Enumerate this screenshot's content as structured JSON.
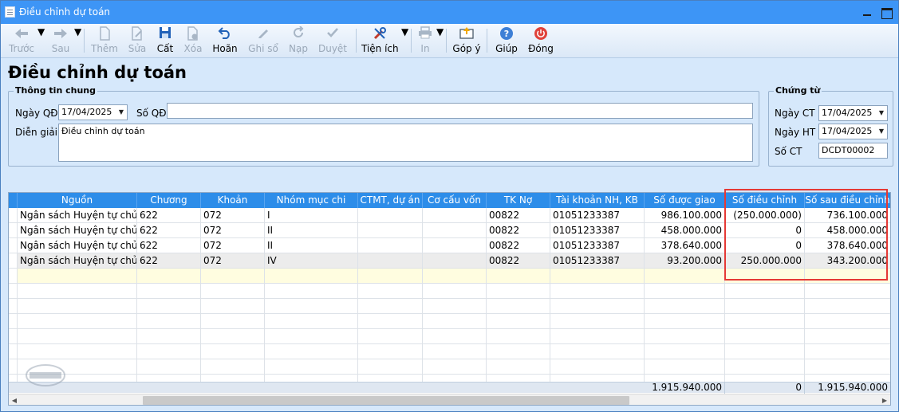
{
  "window": {
    "title": "Điều chỉnh dự toán"
  },
  "toolbar": {
    "prev": "Trước",
    "next": "Sau",
    "add": "Thêm",
    "edit": "Sửa",
    "save": "Cất",
    "delete": "Xóa",
    "undo": "Hoãn",
    "post": "Ghi sổ",
    "reload": "Nạp",
    "approve": "Duyệt",
    "utilities": "Tiện ích",
    "print": "In",
    "feedback": "Góp ý",
    "help": "Giúp",
    "close": "Đóng"
  },
  "page_title": "Điều chỉnh dự toán",
  "general": {
    "legend": "Thông tin chung",
    "decision_date_label": "Ngày QĐ",
    "decision_date": "17/04/2025",
    "decision_no_label": "Số QĐ",
    "decision_no": "",
    "description_label": "Diễn giải",
    "description": "Điều chỉnh dự toán"
  },
  "voucher": {
    "legend": "Chứng từ",
    "voucher_date_label": "Ngày CT",
    "voucher_date": "17/04/2025",
    "accounting_date_label": "Ngày HT",
    "accounting_date": "17/04/2025",
    "voucher_no_label": "Số CT",
    "voucher_no": "DCDT00002"
  },
  "grid": {
    "columns": [
      "Nguồn",
      "Chương",
      "Khoản",
      "Nhóm mục chi",
      "CTMT, dự án",
      "Cơ cấu vốn",
      "TK Nợ",
      "Tài khoản NH, KB",
      "Số được giao",
      "Số điều chỉnh",
      "Số sau điều chỉnh"
    ],
    "rows": [
      [
        "Ngân sách Huyện tự chủ",
        "622",
        "072",
        "I",
        "",
        "",
        "00822",
        "01051233387",
        "986.100.000",
        "(250.000.000)",
        "736.100.000"
      ],
      [
        "Ngân sách Huyện tự chủ",
        "622",
        "072",
        "II",
        "",
        "",
        "00822",
        "01051233387",
        "458.000.000",
        "0",
        "458.000.000"
      ],
      [
        "Ngân sách Huyện tự chủ",
        "622",
        "072",
        "II",
        "",
        "",
        "00822",
        "01051233387",
        "378.640.000",
        "0",
        "378.640.000"
      ],
      [
        "Ngân sách Huyện tự chủ",
        "622",
        "072",
        "IV",
        "",
        "",
        "00822",
        "01051233387",
        "93.200.000",
        "250.000.000",
        "343.200.000"
      ]
    ],
    "totals": {
      "assigned": "1.915.940.000",
      "adjustment": "0",
      "after_adjustment": "1.915.940.000"
    }
  },
  "colors": {
    "titlebar": "#3d95f6",
    "grid_header": "#2d8de9",
    "highlight": "#e53935",
    "background": "#d6e8fb"
  }
}
